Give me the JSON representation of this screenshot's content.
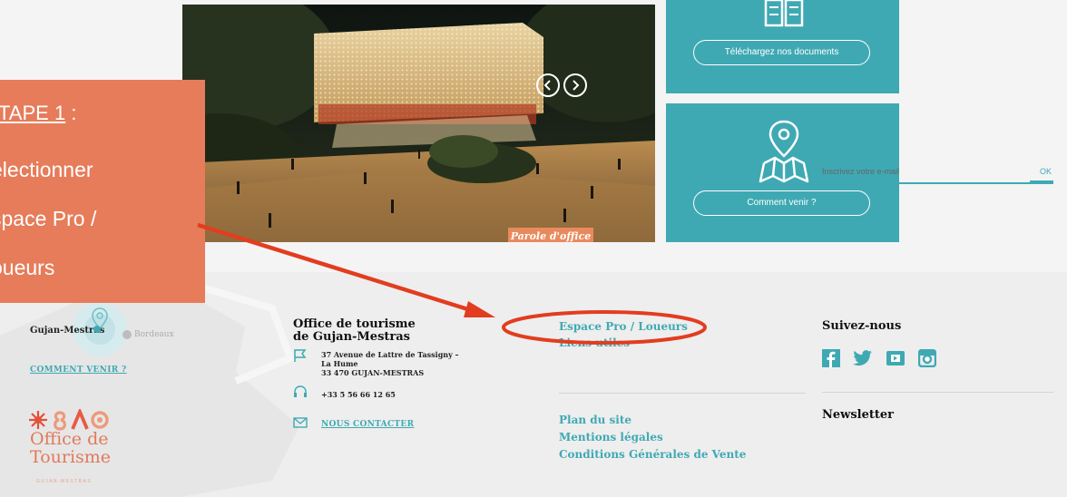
{
  "hero": {
    "caption": "Parole d'office",
    "prev_icon": "chevron-left-icon",
    "next_icon": "chevron-right-icon"
  },
  "tiles": {
    "documents": {
      "label": "Téléchargez nos documents",
      "icon": "open-book-icon"
    },
    "directions": {
      "label": "Comment venir ?",
      "icon": "map-pin-icon"
    }
  },
  "callout": {
    "step": "TAPE 1",
    "colon": ":",
    "lines": [
      "électionner",
      "space Pro /",
      "oueurs"
    ]
  },
  "footer": {
    "map": {
      "city1": "Gujan-Mestras",
      "city2": "Bordeaux",
      "link": "COMMENT VENIR ?"
    },
    "office": {
      "title_line1": "Office de tourisme",
      "title_line2": "de Gujan-Mestras",
      "address_line1": "37 Avenue de Lattre de Tassigny –",
      "address_line2": "La Hume",
      "address_line3": "33 470 GUJAN-MESTRAS",
      "phone": "+33 5 56 66 12 65",
      "contact": "NOUS CONTACTER"
    },
    "links": {
      "pro": "Espace Pro / Loueurs",
      "useful": "Liens utiles",
      "sitemap": "Plan du site",
      "legal": "Mentions légales",
      "terms": "Conditions Générales de Vente"
    },
    "social": {
      "title": "Suivez-nous",
      "icons": [
        "facebook-icon",
        "twitter-icon",
        "youtube-icon",
        "instagram-icon"
      ]
    },
    "newsletter": {
      "title": "Newsletter",
      "placeholder": "Inscrivez votre e-mail",
      "ok": "OK"
    },
    "logo": {
      "line1": "Office de",
      "line2": "Tourisme",
      "sub": "GUJAN-MESTRAS"
    }
  },
  "colors": {
    "accent": "#3fa9b3",
    "callout": "#e67c5a",
    "annotation": "#e23d1f"
  }
}
